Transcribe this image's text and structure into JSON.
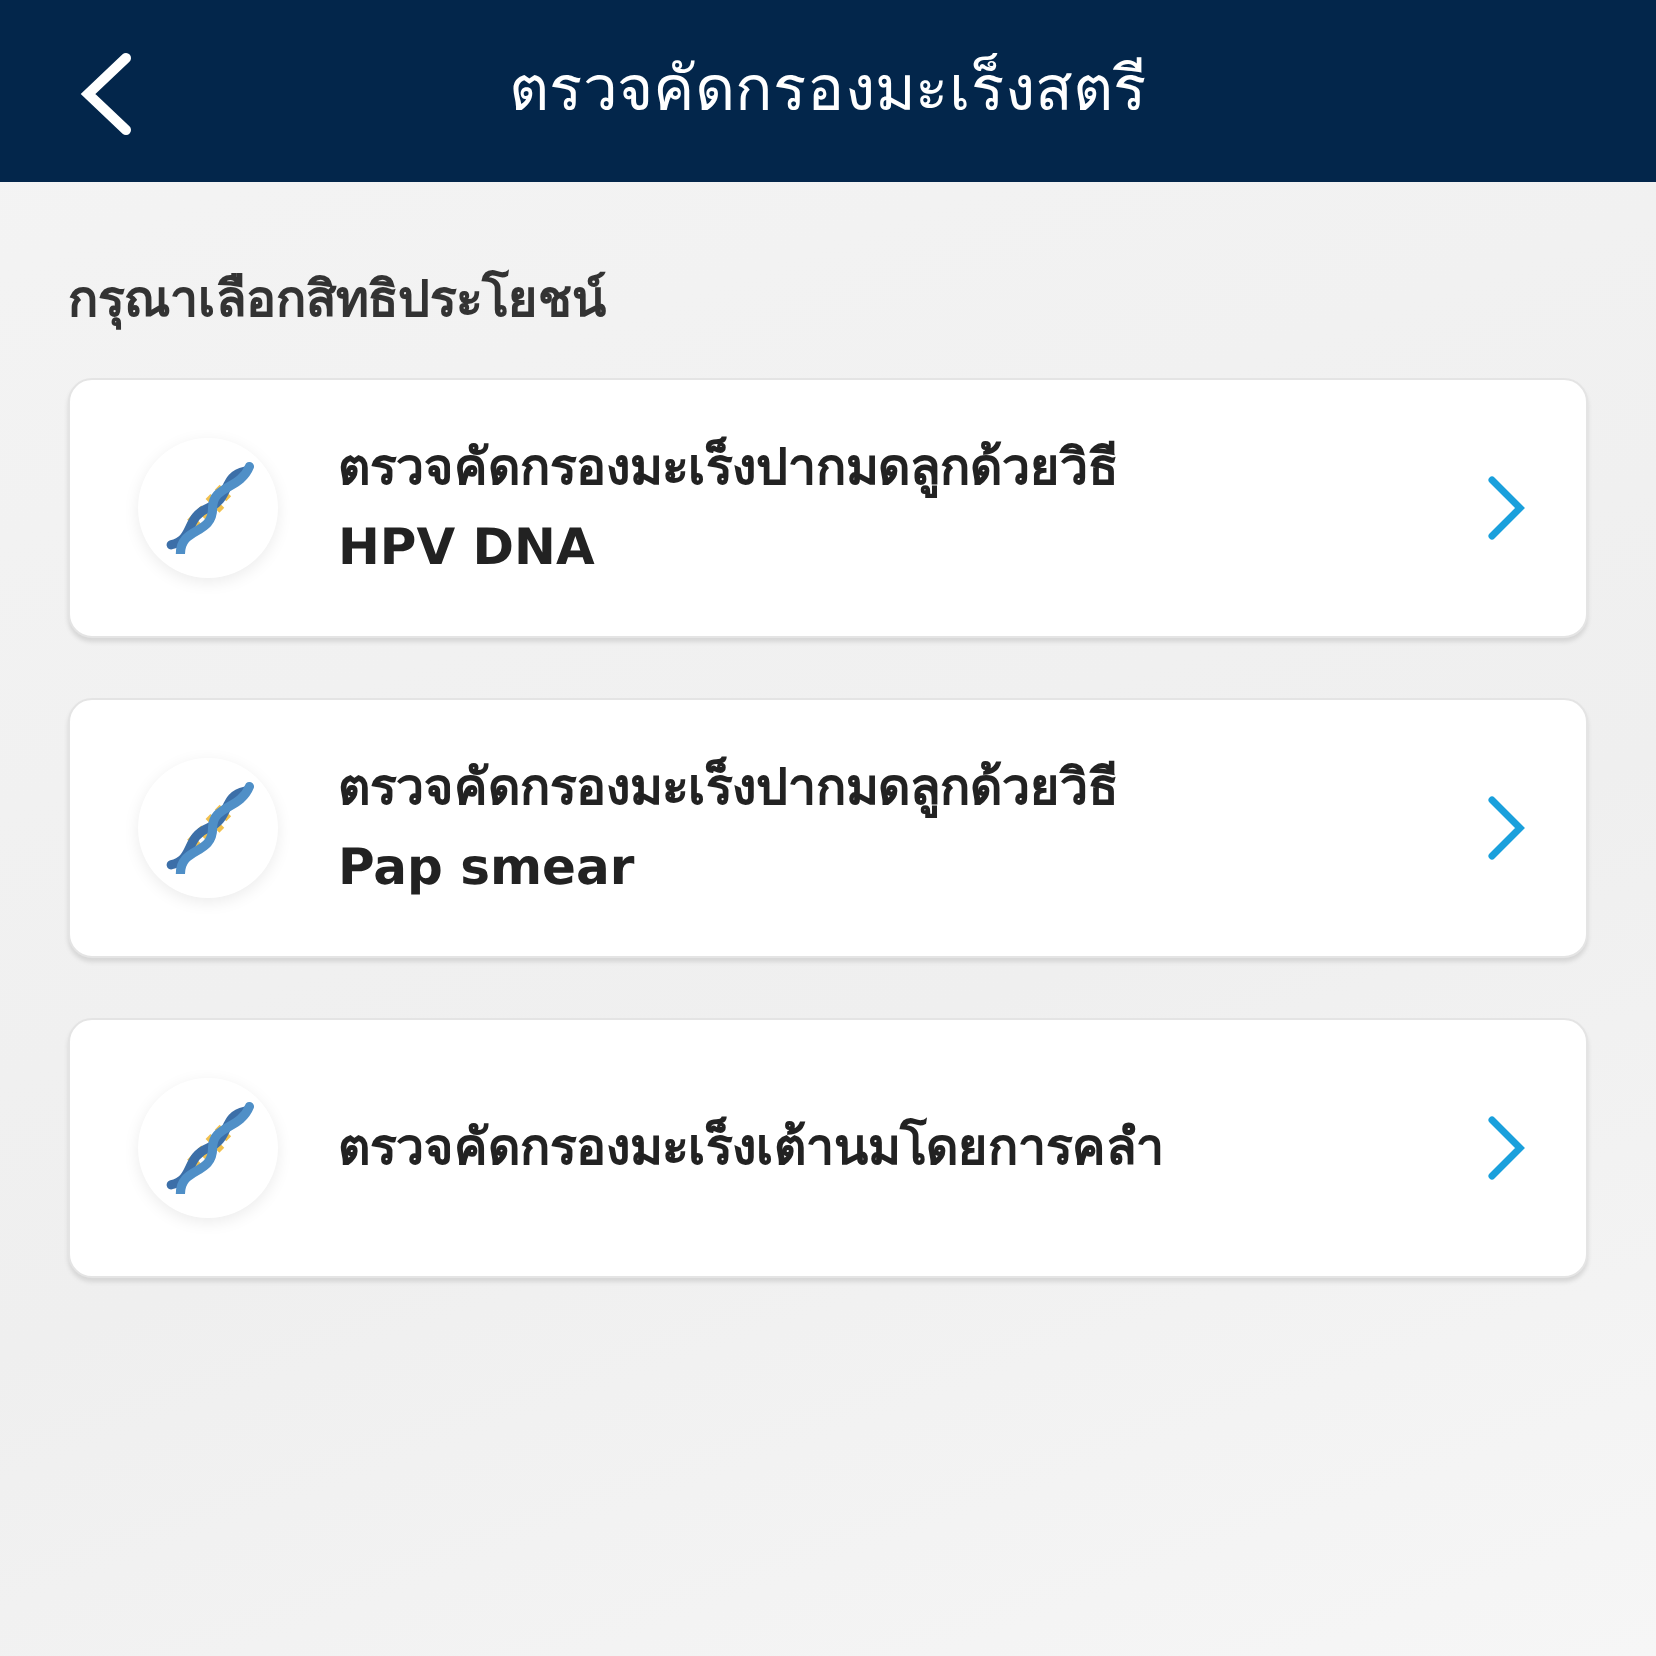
{
  "header": {
    "title": "ตรวจคัดกรองมะเร็งสตรี"
  },
  "section_label": "กรุณาเลือกสิทธิประโยชน์",
  "options": [
    {
      "lines": [
        "ตรวจคัดกรองมะเร็งปากมดลูกด้วยวิธี",
        "HPV DNA"
      ]
    },
    {
      "lines": [
        "ตรวจคัดกรองมะเร็งปากมดลูกด้วยวิธี",
        "Pap smear"
      ]
    },
    {
      "lines": [
        "ตรวจคัดกรองมะเร็งเต้านมโดยการคลำ"
      ]
    }
  ]
}
